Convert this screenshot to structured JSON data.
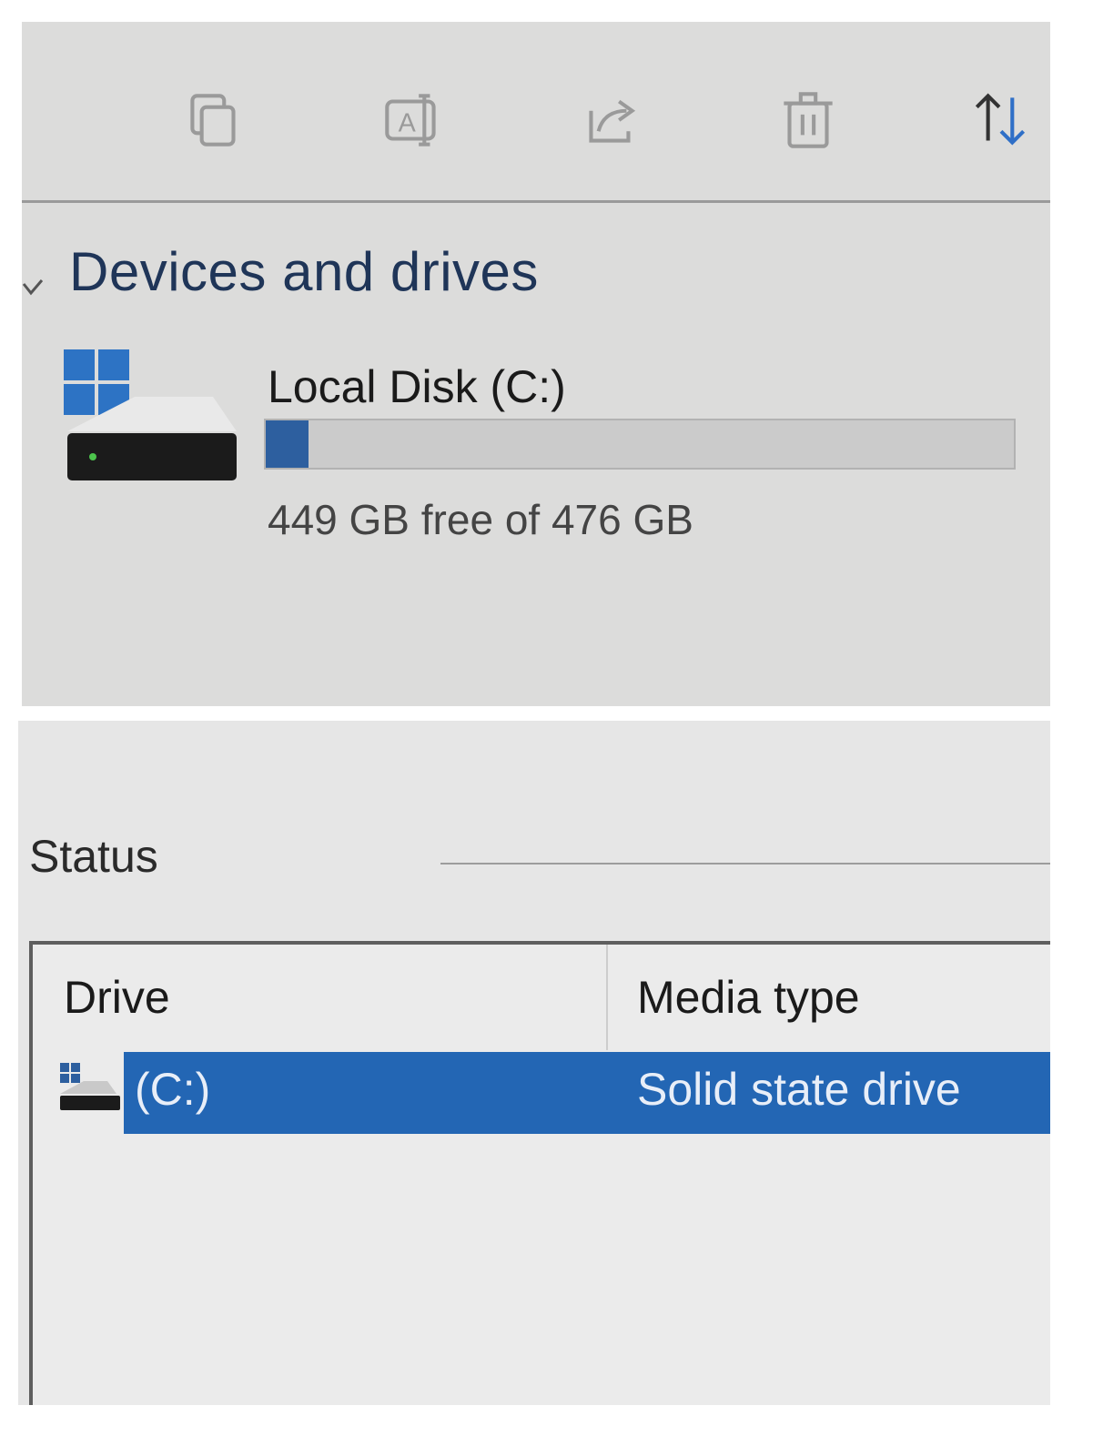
{
  "toolbar": {
    "items": [
      {
        "icon": "copy-icon"
      },
      {
        "icon": "rename-icon"
      },
      {
        "icon": "share-icon"
      },
      {
        "icon": "delete-icon"
      },
      {
        "icon": "sort-icon"
      }
    ],
    "icon_color": "#9a9a9a",
    "accent_color": "#2f6fc7"
  },
  "devices": {
    "section_title": "Devices and drives",
    "drive": {
      "name": "Local Disk (C:)",
      "free_text": "449 GB free of 476 GB",
      "used_fraction": 0.057
    }
  },
  "status": {
    "label": "Status",
    "columns": {
      "drive": "Drive",
      "media_type": "Media type"
    },
    "rows": [
      {
        "drive": "(C:)",
        "media_type": "Solid state drive",
        "selected": true
      }
    ],
    "selection_color": "#2366b4"
  }
}
